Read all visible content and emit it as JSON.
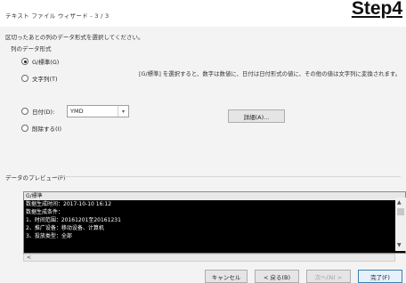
{
  "window": {
    "title": "テキスト ファイル ウィザード - 3 / 3",
    "step_label": "Step4"
  },
  "instruction": "区切ったあとの列のデータ形式を選択してください。",
  "column_format": {
    "group_title": "列のデータ形式",
    "options": [
      {
        "label": "G/標準(G)",
        "checked": true
      },
      {
        "label": "文字列(T)",
        "checked": false
      },
      {
        "label": "日付(D):",
        "checked": false
      },
      {
        "label": "削除する(I)",
        "checked": false
      }
    ],
    "date_select_value": "YMD",
    "description": "[G/標準] を選択すると、数字は数値に、日付は日付形式の値に、その他の値は文字列に変換されます。",
    "detail_button": "詳細(A)..."
  },
  "preview": {
    "title": "データのプレビュー(P)",
    "header": "G/標準",
    "lines": [
      "数据生成时间：2017-10-10 16:12",
      "数据生成条件：",
      "1、时间范围：20161201至20161231",
      "2、推广设备：移动设备、计算机",
      "3、投放类型：全部"
    ]
  },
  "footer": {
    "cancel": "キャンセル",
    "back": "< 戻る(B)",
    "next": "次へ(N) >",
    "finish": "完了(F)"
  }
}
